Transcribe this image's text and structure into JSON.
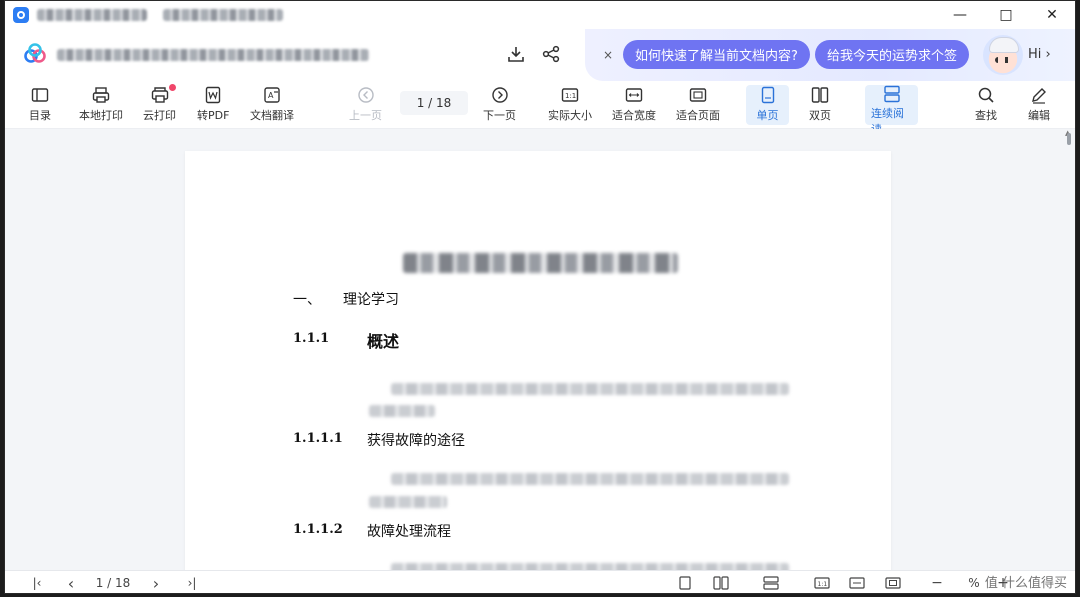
{
  "header": {
    "ai_questions": [
      "如何快速了解当前文档内容?",
      "给我今天的运势求个签"
    ],
    "ai_close": "×",
    "hi": "Hi",
    "hi_chevron": "›"
  },
  "window_controls": {
    "minimize": "—",
    "maximize": "□",
    "close": "✕"
  },
  "toolbar": {
    "toc": "目录",
    "local_print": "本地打印",
    "cloud_print": "云打印",
    "to_pdf": "转PDF",
    "translate": "文档翻译",
    "prev_page": "上一页",
    "page_indicator": "1 / 18",
    "next_page": "下一页",
    "actual_size": "实际大小",
    "fit_width": "适合宽度",
    "fit_page": "适合页面",
    "single_page": "单页",
    "double_page": "双页",
    "continuous": "连续阅读",
    "find": "查找",
    "edit": "编辑"
  },
  "document": {
    "section_num": "一、",
    "section_title": "理论学习",
    "h1_num": "1.1.1",
    "h1_title": "概述",
    "h2_num": "1.1.1.1",
    "h2_title": "获得故障的途径",
    "h3_num": "1.1.1.2",
    "h3_title": "故障处理流程"
  },
  "statusbar": {
    "first": "|‹",
    "prev": "‹",
    "page_indicator": "1 / 18",
    "next": "›",
    "last": "›|",
    "zoom_out": "−",
    "zoom_value": "%",
    "zoom_in": "+",
    "watermark": "值 什么值得买"
  },
  "colors": {
    "accent": "#2a72d8",
    "ai_pill": "#6f74f2",
    "badge": "#f0466a"
  }
}
